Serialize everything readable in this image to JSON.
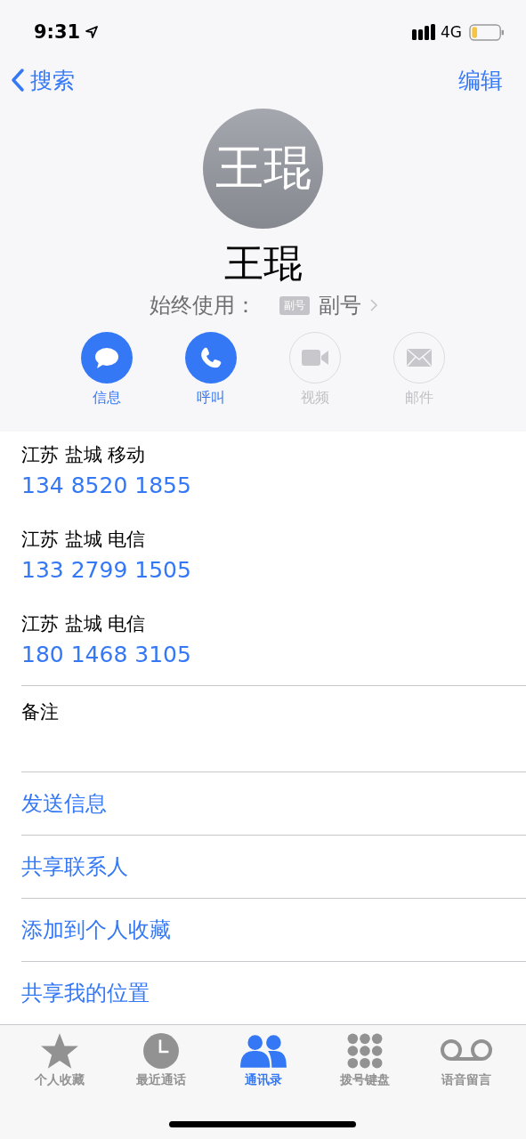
{
  "status_bar": {
    "time": "9:31",
    "network": "4G"
  },
  "nav": {
    "back": "搜索",
    "edit": "编辑"
  },
  "contact": {
    "initials": "王琨",
    "name": "王琨",
    "default_label": "始终使用：",
    "line_badge": "副号",
    "line_name": "副号"
  },
  "actions": [
    {
      "kind": "message",
      "label": "信息",
      "disabled": false
    },
    {
      "kind": "call",
      "label": "呼叫",
      "disabled": false
    },
    {
      "kind": "video",
      "label": "视频",
      "disabled": true
    },
    {
      "kind": "mail",
      "label": "邮件",
      "disabled": true
    }
  ],
  "phones": [
    {
      "label": "江苏 盐城 移动",
      "number": "134 8520 1855"
    },
    {
      "label": "江苏 盐城 电信",
      "number": "133 2799 1505"
    },
    {
      "label": "江苏 盐城 电信",
      "number": "180 1468 3105"
    }
  ],
  "notes": {
    "label": "备注"
  },
  "links": [
    "发送信息",
    "共享联系人",
    "添加到个人收藏",
    "共享我的位置"
  ],
  "tabs": [
    {
      "kind": "favorites",
      "label": "个人收藏",
      "selected": false
    },
    {
      "kind": "recents",
      "label": "最近通话",
      "selected": false
    },
    {
      "kind": "contacts",
      "label": "通讯录",
      "selected": true
    },
    {
      "kind": "keypad",
      "label": "拨号键盘",
      "selected": false
    },
    {
      "kind": "voicemail",
      "label": "语音留言",
      "selected": false
    }
  ]
}
